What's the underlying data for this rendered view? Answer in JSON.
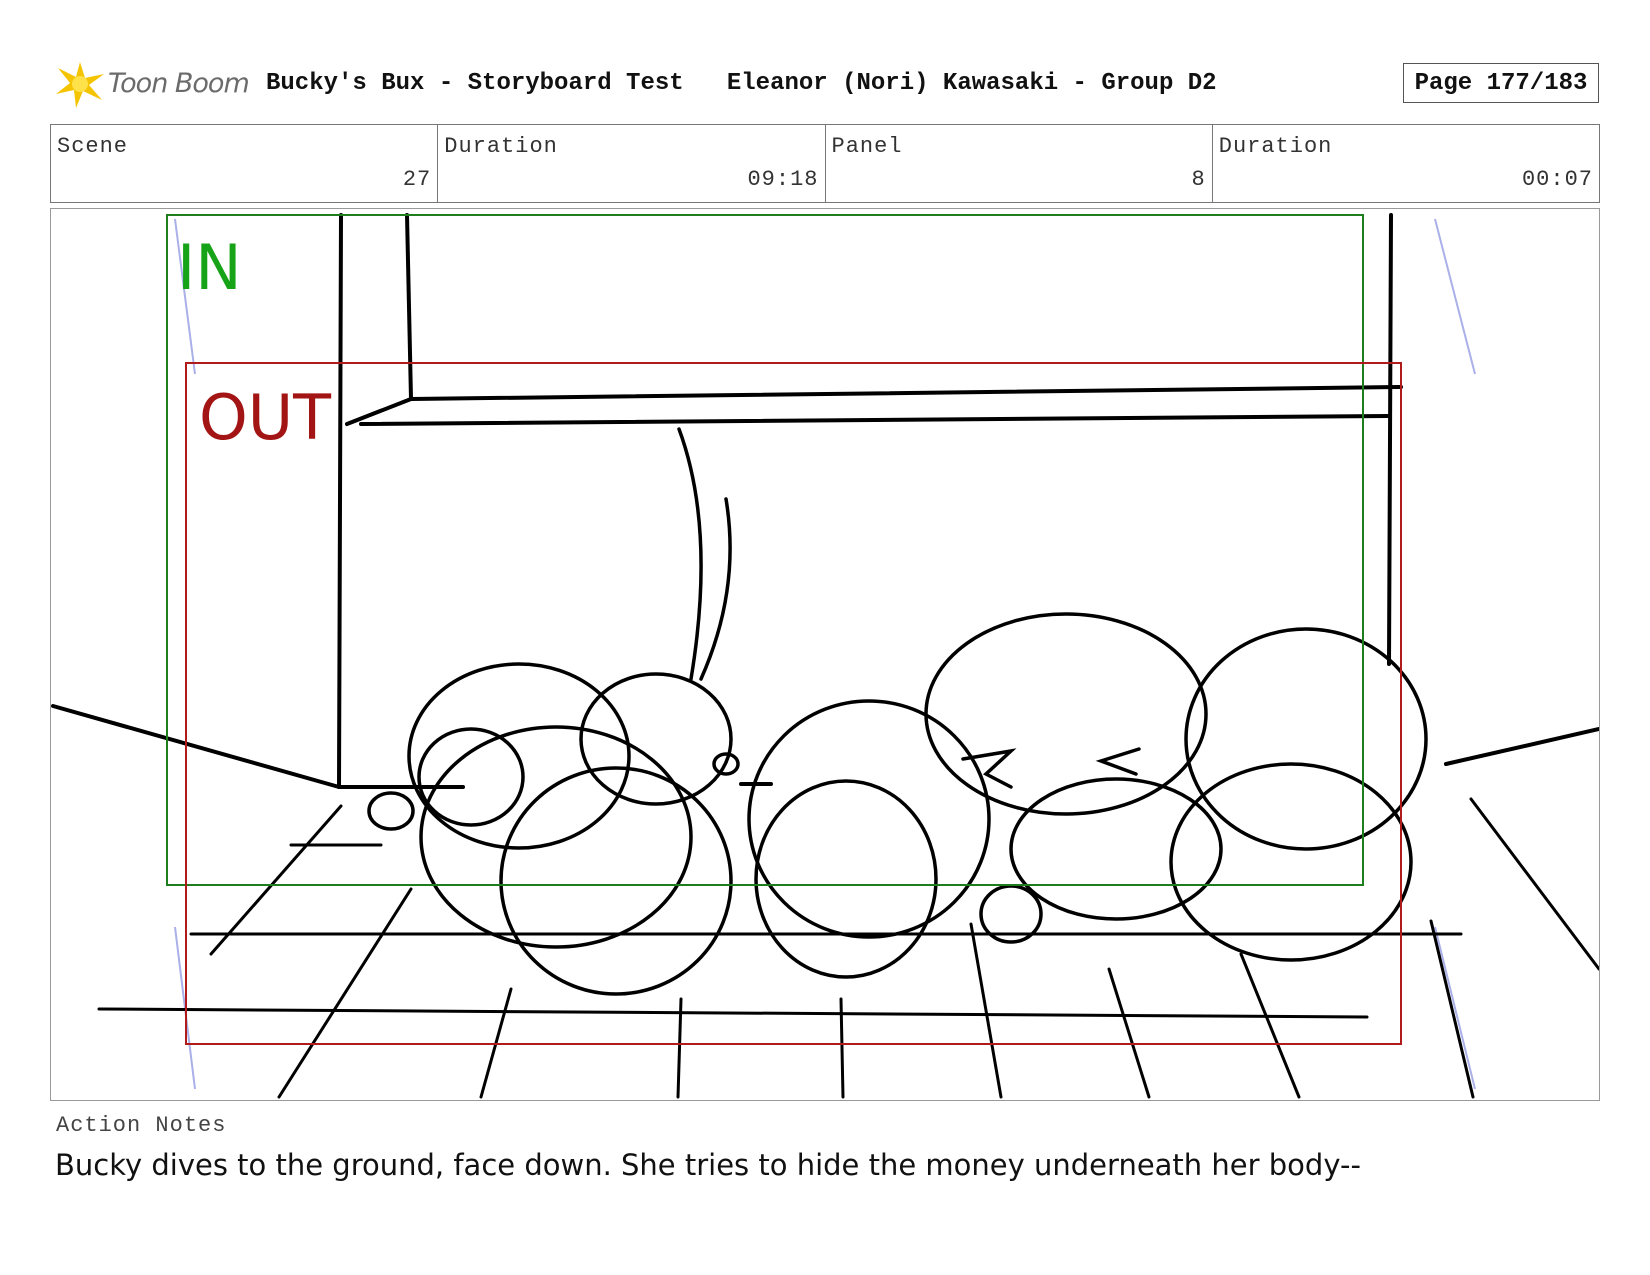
{
  "header": {
    "logo_text": "Toon Boom",
    "title": "Bucky's Bux - Storyboard Test   Eleanor (Nori) Kawasaki - Group D2",
    "page": "Page 177/183"
  },
  "info": [
    {
      "label": "Scene",
      "value": "27"
    },
    {
      "label": "Duration",
      "value": "09:18"
    },
    {
      "label": "Panel",
      "value": "8"
    },
    {
      "label": "Duration",
      "value": "00:07"
    }
  ],
  "panel": {
    "in_label": "IN",
    "out_label": "OUT",
    "colors": {
      "in_frame": "#1e7e1e",
      "in_text": "#17a317",
      "out_frame": "#b01c1c",
      "out_text": "#a31515",
      "guide": "#aab0e8"
    }
  },
  "notes": {
    "label": "Action Notes",
    "text": "Bucky dives to the ground, face down. She tries to hide the money underneath her body--"
  }
}
